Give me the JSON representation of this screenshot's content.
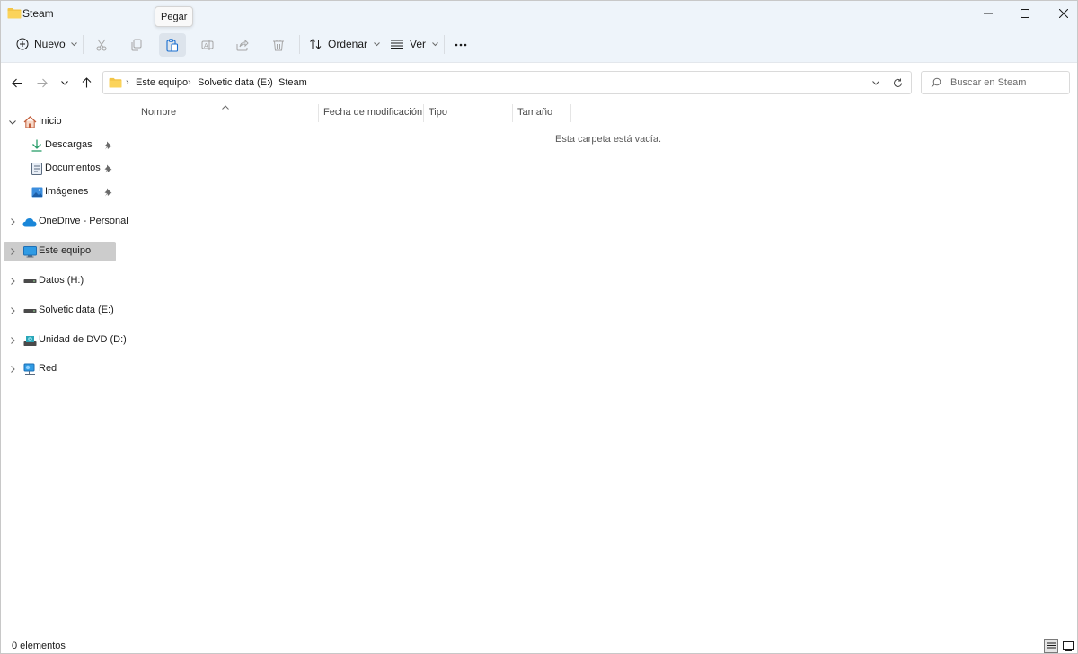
{
  "window": {
    "title": "Steam",
    "icons": {
      "folder": "folder-icon",
      "minimize": "minimize-icon",
      "maximize": "maximize-icon",
      "close": "close-icon"
    }
  },
  "commandbar": {
    "new_label": "Nuevo",
    "sort_label": "Ordenar",
    "view_label": "Ver",
    "tooltip": "Pegar",
    "icons": [
      "cut-icon",
      "copy-icon",
      "paste-icon",
      "rename-icon",
      "share-icon",
      "delete-icon",
      "more-icon"
    ]
  },
  "addressbar": {
    "breadcrumbs": [
      "Este equipo",
      "Solvetic data (E:)",
      "Steam"
    ],
    "search_placeholder": "Buscar en Steam"
  },
  "sidebar": {
    "items": [
      {
        "label": "Inicio",
        "icon": "home-icon"
      },
      {
        "label": "Descargas",
        "icon": "download-icon",
        "pinned": true
      },
      {
        "label": "Documentos",
        "icon": "documents-icon",
        "pinned": true
      },
      {
        "label": "Imágenes",
        "icon": "pictures-icon",
        "pinned": true
      },
      {
        "label": "OneDrive - Personal",
        "icon": "onedrive-cloud-icon"
      },
      {
        "label": "Este equipo",
        "icon": "this-pc-icon",
        "selected": true
      },
      {
        "label": "Datos (H:)",
        "icon": "drive-icon"
      },
      {
        "label": "Solvetic data (E:)",
        "icon": "drive-icon"
      },
      {
        "label": "Unidad de DVD (D:)",
        "icon": "dvd-drive-icon"
      },
      {
        "label": "Red",
        "icon": "network-icon"
      }
    ]
  },
  "content": {
    "columns": [
      "Nombre",
      "Fecha de modificación",
      "Tipo",
      "Tamaño"
    ],
    "empty_message": "Esta carpeta está vacía."
  },
  "statusbar": {
    "count": "0 elementos"
  },
  "colors": {
    "chrome_bg": "#eef4fa",
    "selected_bg": "#cccccc",
    "folder_yellow": "#f3c547",
    "accent_blue": "#1a86d8"
  }
}
